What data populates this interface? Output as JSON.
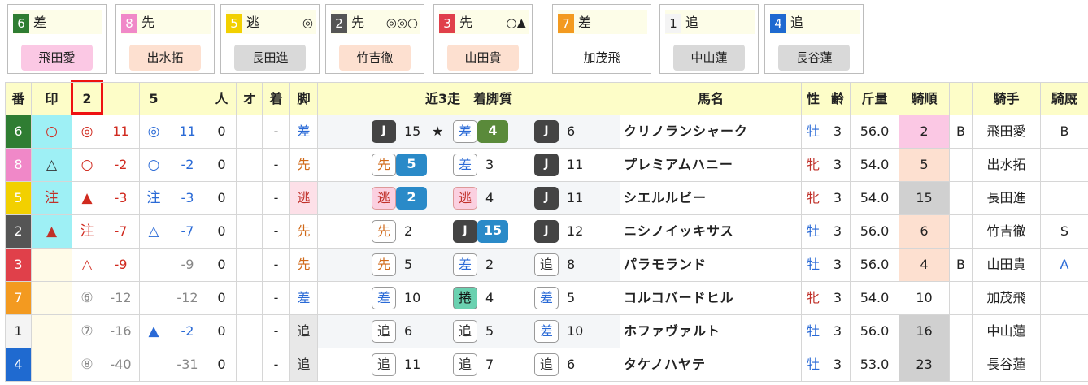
{
  "cards": [
    {
      "num": "6",
      "num_color": "#2f7d32",
      "style": "差",
      "marks": "",
      "jockey": "飛田愛",
      "jk_bg": "#fbc8e4"
    },
    {
      "num": "8",
      "num_color": "#f088c8",
      "style": "先",
      "marks": "",
      "jockey": "出水拓",
      "jk_bg": "#fde0d0"
    },
    {
      "num": "5",
      "num_color": "#f2d000",
      "style": "逃",
      "marks": "◎",
      "jockey": "長田進",
      "jk_bg": "#d9d9d9"
    },
    {
      "num": "2",
      "num_color": "#555555",
      "style": "先",
      "marks": "◎◎○",
      "jockey": "竹吉徹",
      "jk_bg": "#fde0d0"
    },
    {
      "num": "3",
      "num_color": "#e0404a",
      "style": "先",
      "marks": "○▲",
      "jockey": "山田貴",
      "jk_bg": "#fde0d0"
    },
    {
      "num": "7",
      "num_color": "#f39a20",
      "style": "差",
      "marks": "",
      "jockey": "加茂飛",
      "jk_bg": "#ffffff"
    },
    {
      "num": "1",
      "num_color": "#f4f4f4",
      "style": "追",
      "marks": "",
      "jockey": "中山蓮",
      "jk_bg": "#d9d9d9"
    },
    {
      "num": "4",
      "num_color": "#1f6ad0",
      "style": "追",
      "marks": "",
      "jockey": "長谷蓮",
      "jk_bg": "#d9d9d9"
    }
  ],
  "headers": {
    "ban": "番",
    "shirushi": "印",
    "col2": "2",
    "col5": "5",
    "hito": "人",
    "o": "オ",
    "chaku": "着",
    "ashi": "脚",
    "recent": "近3走　着脚質",
    "name": "馬名",
    "sex": "性",
    "age": "齢",
    "weight": "斤量",
    "rank": "騎順",
    "jockey": "騎手",
    "kyusha": "騎厩"
  },
  "rows": [
    {
      "ban": "6",
      "ban_color": "#2f7d32",
      "mark": "○",
      "m2": "◎",
      "v2": "11",
      "m5": "◎",
      "v5": "11",
      "hito": "0",
      "chaku": "-",
      "ashi": "差",
      "r1s": "J",
      "r1n": "15",
      "star": "★",
      "r2s": "差",
      "r2n": "4",
      "r3s": "J",
      "r3n": "6",
      "name": "クリノランシャーク",
      "sex": "牡",
      "age": "3",
      "weight": "56.0",
      "rank": "2",
      "bflag": "B",
      "jockey": "飛田愛",
      "kyusha": "B"
    },
    {
      "ban": "8",
      "ban_color": "#f088c8",
      "mark": "△",
      "m2": "○",
      "v2": "-2",
      "m5": "○",
      "v5": "-2",
      "hito": "0",
      "chaku": "-",
      "ashi": "先",
      "r1s": "先",
      "r1n": "5",
      "star": "",
      "r2s": "差",
      "r2n": "3",
      "r3s": "J",
      "r3n": "11",
      "name": "プレミアムハニー",
      "sex": "牝",
      "age": "3",
      "weight": "54.0",
      "rank": "5",
      "bflag": "",
      "jockey": "出水拓",
      "kyusha": ""
    },
    {
      "ban": "5",
      "ban_color": "#f2d000",
      "mark": "注",
      "m2": "▲",
      "v2": "-3",
      "m5": "注",
      "v5": "-3",
      "hito": "0",
      "chaku": "-",
      "ashi": "逃",
      "r1s": "逃",
      "r1n": "2",
      "star": "",
      "r2s": "逃",
      "r2n": "4",
      "r3s": "J",
      "r3n": "11",
      "name": "シエルルビー",
      "sex": "牝",
      "age": "3",
      "weight": "54.0",
      "rank": "15",
      "bflag": "",
      "jockey": "長田進",
      "kyusha": ""
    },
    {
      "ban": "2",
      "ban_color": "#555555",
      "mark": "▲",
      "m2": "注",
      "v2": "-7",
      "m5": "△",
      "v5": "-7",
      "hito": "0",
      "chaku": "-",
      "ashi": "先",
      "r1s": "先",
      "r1n": "2",
      "star": "",
      "r2s": "J",
      "r2n": "15",
      "r3s": "J",
      "r3n": "12",
      "name": "ニシノイッキサス",
      "sex": "牡",
      "age": "3",
      "weight": "56.0",
      "rank": "6",
      "bflag": "",
      "jockey": "竹吉徹",
      "kyusha": "S"
    },
    {
      "ban": "3",
      "ban_color": "#e0404a",
      "mark": "",
      "m2": "△",
      "v2": "-9",
      "m5": "",
      "v5": "-9",
      "hito": "0",
      "chaku": "-",
      "ashi": "先",
      "r1s": "先",
      "r1n": "5",
      "star": "",
      "r2s": "差",
      "r2n": "2",
      "r3s": "追",
      "r3n": "8",
      "name": "パラモランド",
      "sex": "牡",
      "age": "3",
      "weight": "56.0",
      "rank": "4",
      "bflag": "B",
      "jockey": "山田貴",
      "kyusha": "A"
    },
    {
      "ban": "7",
      "ban_color": "#f39a20",
      "mark": "",
      "m2": "⑥",
      "v2": "-12",
      "m5": "",
      "v5": "-12",
      "hito": "0",
      "chaku": "-",
      "ashi": "差",
      "r1s": "差",
      "r1n": "10",
      "star": "",
      "r2s": "捲",
      "r2n": "4",
      "r3s": "差",
      "r3n": "5",
      "name": "コルコバードヒル",
      "sex": "牝",
      "age": "3",
      "weight": "54.0",
      "rank": "10",
      "bflag": "",
      "jockey": "加茂飛",
      "kyusha": ""
    },
    {
      "ban": "1",
      "ban_color": "#f4f4f4",
      "mark": "",
      "m2": "⑦",
      "v2": "-16",
      "m5": "▲",
      "v5": "-2",
      "hito": "0",
      "chaku": "-",
      "ashi": "追",
      "r1s": "追",
      "r1n": "6",
      "star": "",
      "r2s": "追",
      "r2n": "5",
      "r3s": "差",
      "r3n": "10",
      "name": "ホファヴァルト",
      "sex": "牡",
      "age": "3",
      "weight": "56.0",
      "rank": "16",
      "bflag": "",
      "jockey": "中山蓮",
      "kyusha": ""
    },
    {
      "ban": "4",
      "ban_color": "#1f6ad0",
      "mark": "",
      "m2": "⑧",
      "v2": "-40",
      "m5": "",
      "v5": "-31",
      "hito": "0",
      "chaku": "-",
      "ashi": "追",
      "r1s": "追",
      "r1n": "11",
      "star": "",
      "r2s": "追",
      "r2n": "7",
      "r3s": "追",
      "r3n": "6",
      "name": "タケノハヤテ",
      "sex": "牡",
      "age": "3",
      "weight": "53.0",
      "rank": "23",
      "bflag": "",
      "jockey": "長谷蓮",
      "kyusha": ""
    }
  ]
}
